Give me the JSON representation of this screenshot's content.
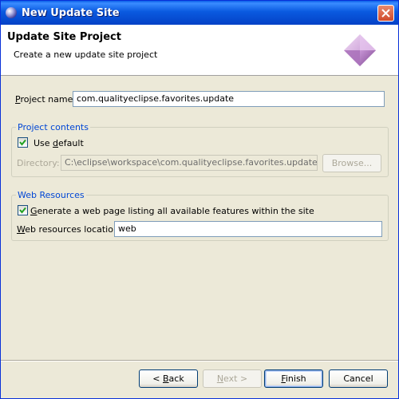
{
  "window": {
    "title": "New Update Site"
  },
  "header": {
    "title": "Update Site Project",
    "description": "Create a new update site project"
  },
  "project_name": {
    "label": "Project name:",
    "value": "com.qualityeclipse.favorites.update"
  },
  "project_contents": {
    "title": "Project contents",
    "use_default": {
      "label": "Use default",
      "checked": true
    },
    "directory": {
      "label": "Directory:",
      "value": "C:\\eclipse\\workspace\\com.qualityeclipse.favorites.update",
      "enabled": false
    },
    "browse_label": "Browse..."
  },
  "web_resources": {
    "title": "Web Resources",
    "generate": {
      "label": "Generate a web page listing all available features within the site",
      "checked": true
    },
    "location": {
      "label": "Web resources location:",
      "value": "web"
    }
  },
  "buttons": {
    "back": "< Back",
    "next": "Next >",
    "finish": "Finish",
    "cancel": "Cancel"
  }
}
